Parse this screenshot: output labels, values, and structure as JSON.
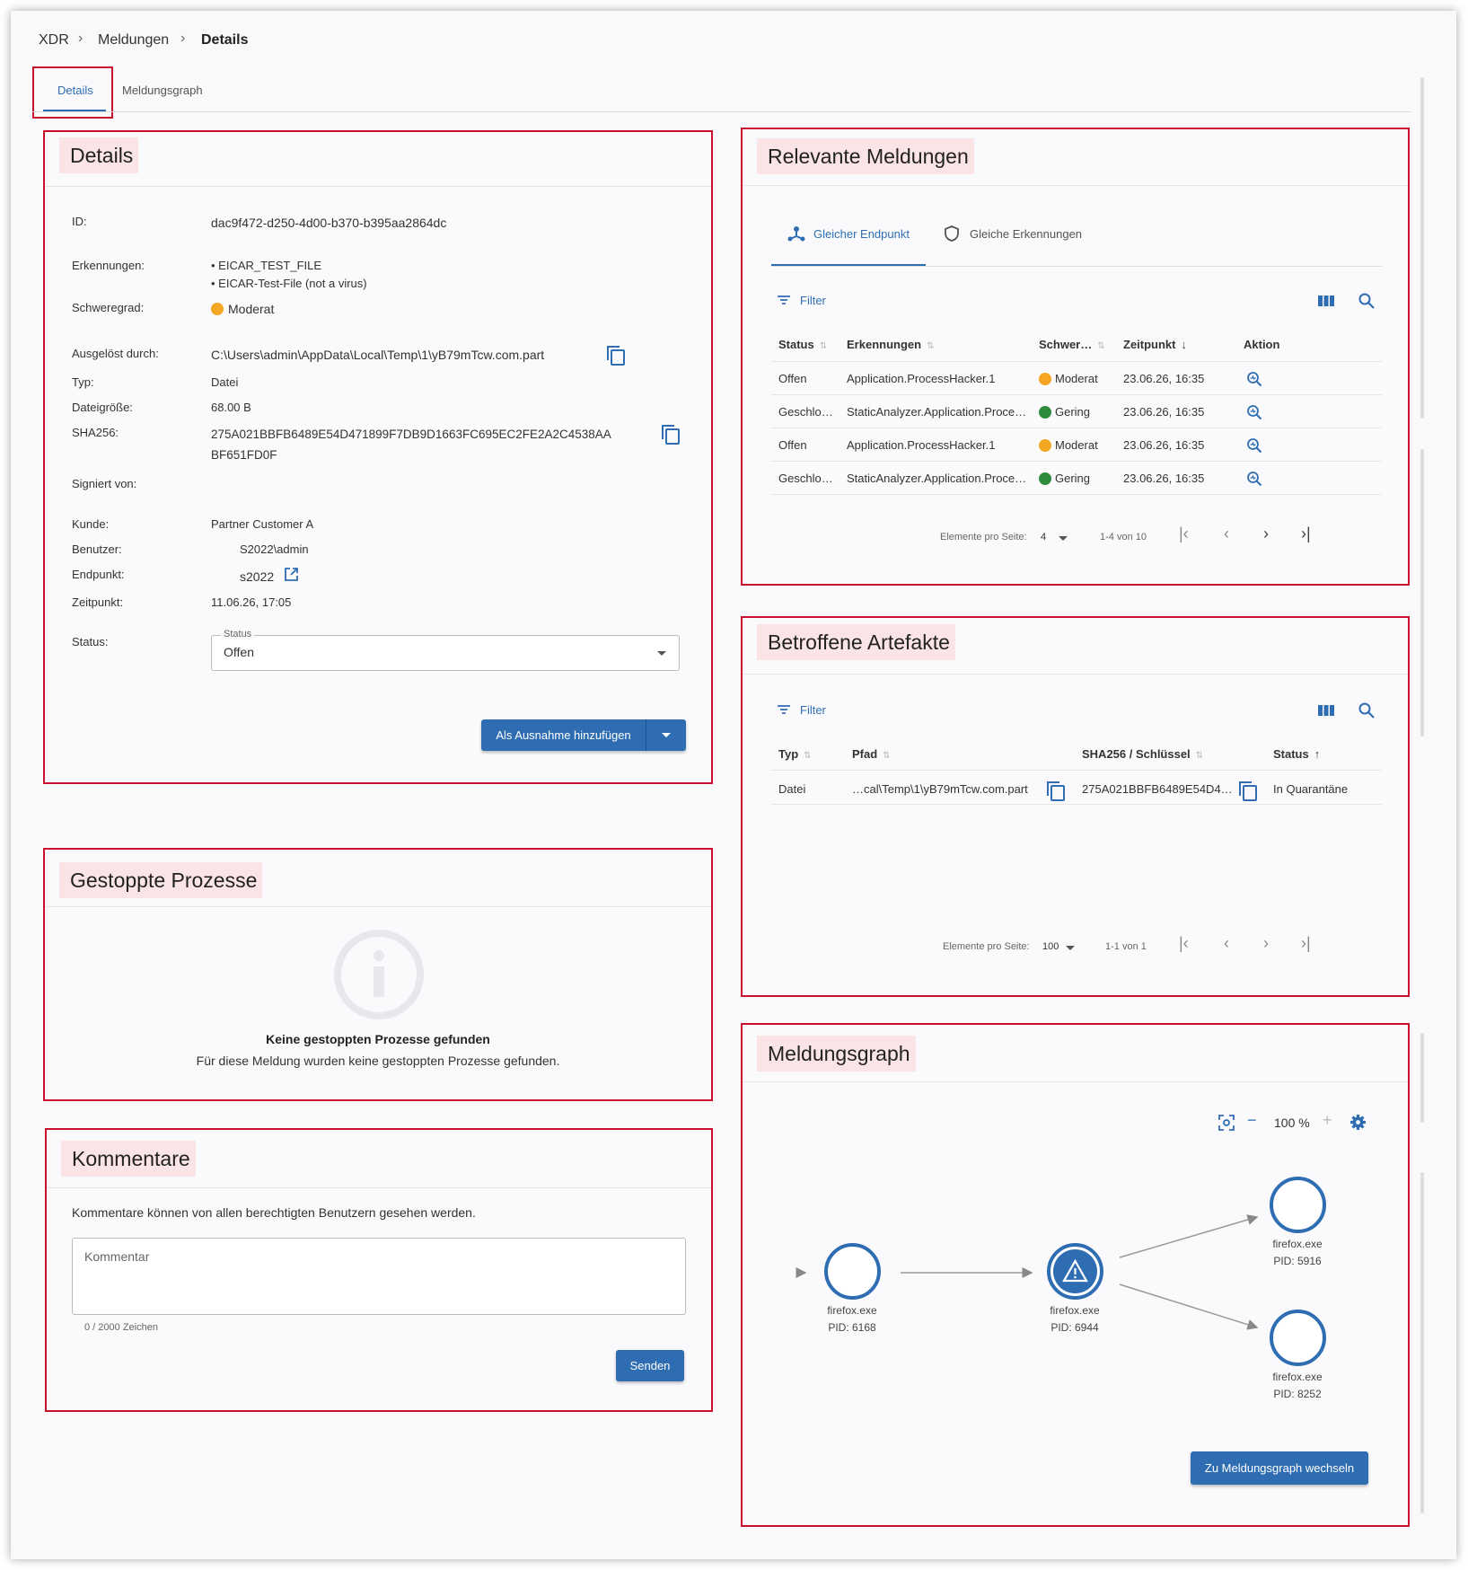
{
  "breadcrumb": [
    "XDR",
    "Meldungen",
    "Details"
  ],
  "tabs": {
    "details": "Details",
    "graph": "Meldungsgraph"
  },
  "details": {
    "title": "Details",
    "id_label": "ID:",
    "id": "dac9f472-d250-4d00-b370-b395aa2864dc",
    "detections_label": "Erkennungen:",
    "detections": [
      "EICAR_TEST_FILE",
      "EICAR-Test-File (not a virus)"
    ],
    "severity_label": "Schweregrad:",
    "severity": "Moderat",
    "trigger_label": "Ausgelöst durch:",
    "trigger": "C:\\Users\\admin\\AppData\\Local\\Temp\\1\\yB79mTcw.com.part",
    "type_label": "Typ:",
    "type": "Datei",
    "size_label": "Dateigröße:",
    "size": "68.00 B",
    "sha_label": "SHA256:",
    "sha_line1": "275A021BBFB6489E54D471899F7DB9D1663FC695EC2FE2A2C4538AA",
    "sha_line2": "BF651FD0F",
    "signed_label": "Signiert von:",
    "customer_label": "Kunde:",
    "customer": "Partner Customer A",
    "user_label": "Benutzer:",
    "user": "S2022\\admin",
    "endpoint_label": "Endpunkt:",
    "endpoint": "s2022",
    "time_label": "Zeitpunkt:",
    "time": "11.06.26, 17:05",
    "status_label": "Status:",
    "status_legend": "Status",
    "status_value": "Offen",
    "exception_button": "Als Ausnahme hinzufügen"
  },
  "relevant": {
    "title": "Relevante Meldungen",
    "tab_same_endpoint": "Gleicher Endpunkt",
    "tab_same_detections": "Gleiche Erkennungen",
    "filter": "Filter",
    "columns": [
      "Status",
      "Erkennungen",
      "Schwer…",
      "Zeitpunkt",
      "Aktion"
    ],
    "rows": [
      {
        "status": "Offen",
        "detection": "Application.ProcessHacker.1",
        "severity": "Moderat",
        "severity_color": "#f5a623",
        "time": "23.06.26, 16:35"
      },
      {
        "status": "Geschlo…",
        "detection": "StaticAnalyzer.Application.Proce…",
        "severity": "Gering",
        "severity_color": "#2e8b3e",
        "time": "23.06.26, 16:35"
      },
      {
        "status": "Offen",
        "detection": "Application.ProcessHacker.1",
        "severity": "Moderat",
        "severity_color": "#f5a623",
        "time": "23.06.26, 16:35"
      },
      {
        "status": "Geschlo…",
        "detection": "StaticAnalyzer.Application.Proce…",
        "severity": "Gering",
        "severity_color": "#2e8b3e",
        "time": "23.06.26, 16:35"
      }
    ],
    "per_page_label": "Elemente pro Seite:",
    "per_page": "4",
    "range": "1-4 von 10"
  },
  "artifacts": {
    "title": "Betroffene Artefakte",
    "filter": "Filter",
    "columns": [
      "Typ",
      "Pfad",
      "SHA256 / Schlüssel",
      "Status"
    ],
    "rows": [
      {
        "type": "Datei",
        "path": "…cal\\Temp\\1\\yB79mTcw.com.part",
        "sha": "275A021BBFB6489E54D4…",
        "status": "In Quarantäne"
      }
    ],
    "per_page_label": "Elemente pro Seite:",
    "per_page": "100",
    "range": "1-1 von 1"
  },
  "stopped": {
    "title": "Gestoppte Prozesse",
    "empty_title": "Keine gestoppten Prozesse gefunden",
    "empty_text": "Für diese Meldung wurden keine gestoppten Prozesse gefunden."
  },
  "comments": {
    "title": "Kommentare",
    "info": "Kommentare können von allen berechtigten Benutzern gesehen werden.",
    "placeholder": "Kommentar",
    "counter": "0 / 2000 Zeichen",
    "send": "Senden"
  },
  "graph": {
    "title": "Meldungsgraph",
    "zoom": "100 %",
    "nodes": [
      {
        "name": "firefox.exe",
        "pid": "PID: 6168"
      },
      {
        "name": "firefox.exe",
        "pid": "PID: 6944"
      },
      {
        "name": "firefox.exe",
        "pid": "PID: 5916"
      },
      {
        "name": "firefox.exe",
        "pid": "PID: 8252"
      }
    ],
    "switch_button": "Zu Meldungsgraph wechseln"
  },
  "colors": {
    "accent": "#2f6db3",
    "highlight": "#c8102e",
    "moderate": "#f5a623",
    "low": "#2e8b3e"
  }
}
